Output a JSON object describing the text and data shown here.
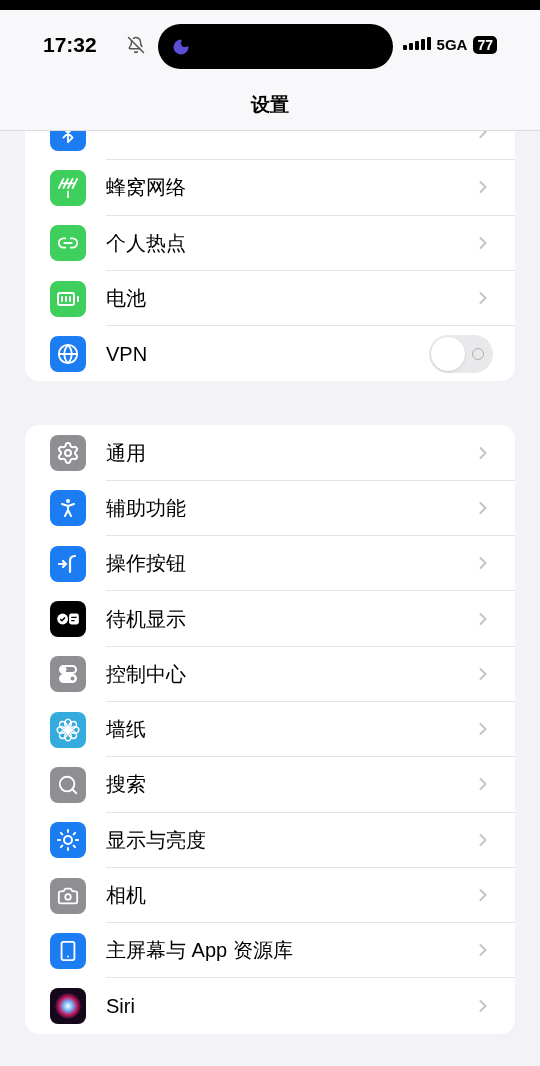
{
  "status_bar": {
    "time": "17:32",
    "network": "5GA",
    "battery": "77"
  },
  "header": {
    "title": "设置"
  },
  "groups": [
    {
      "rows": [
        {
          "kind": "link"
        },
        {
          "kind": "link",
          "label": "蜂窝网络"
        },
        {
          "kind": "link",
          "label": "个人热点"
        },
        {
          "kind": "link",
          "label": "电池"
        },
        {
          "kind": "toggle",
          "label": "VPN",
          "on": false
        }
      ]
    },
    {
      "rows": [
        {
          "kind": "link",
          "label": "通用"
        },
        {
          "kind": "link",
          "label": "辅助功能"
        },
        {
          "kind": "link",
          "label": "操作按钮"
        },
        {
          "kind": "link",
          "label": "待机显示"
        },
        {
          "kind": "link",
          "label": "控制中心"
        },
        {
          "kind": "link",
          "label": "墙纸"
        },
        {
          "kind": "link",
          "label": "搜索"
        },
        {
          "kind": "link",
          "label": "显示与亮度"
        },
        {
          "kind": "link",
          "label": "相机"
        },
        {
          "kind": "link",
          "label": "主屏幕与 App 资源库"
        },
        {
          "kind": "link",
          "label": "Siri"
        }
      ]
    }
  ]
}
